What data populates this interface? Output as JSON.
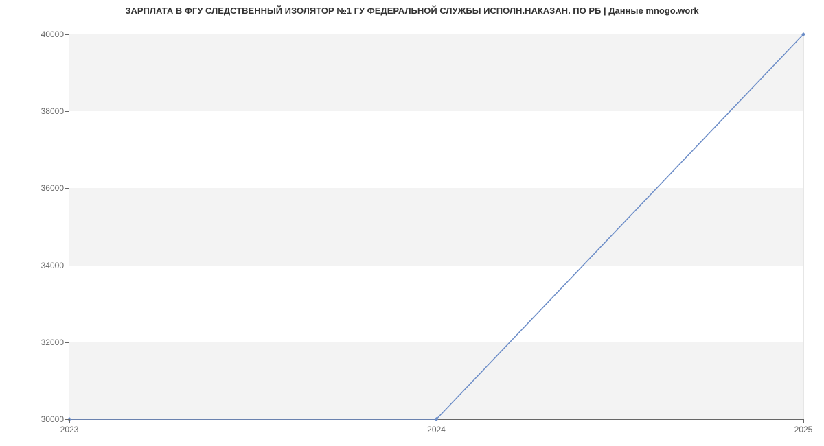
{
  "chart_data": {
    "type": "line",
    "title": "ЗАРПЛАТА В ФГУ СЛЕДСТВЕННЫЙ ИЗОЛЯТОР №1 ГУ ФЕДЕРАЛЬНОЙ СЛУЖБЫ ИСПОЛН.НАКАЗАН. ПО РБ | Данные mnogo.work",
    "xlabel": "",
    "ylabel": "",
    "x": [
      2023,
      2024,
      2025
    ],
    "y": [
      30000,
      30000,
      40000
    ],
    "xlim": [
      2023,
      2025
    ],
    "ylim": [
      30000,
      40000
    ],
    "y_ticks": [
      30000,
      32000,
      34000,
      36000,
      38000,
      40000
    ],
    "x_ticks": [
      2023,
      2024,
      2025
    ],
    "bands": [
      {
        "y0": 30000,
        "y1": 32000,
        "color": "#f3f3f3"
      },
      {
        "y0": 34000,
        "y1": 36000,
        "color": "#f3f3f3"
      },
      {
        "y0": 38000,
        "y1": 40000,
        "color": "#f3f3f3"
      }
    ],
    "line_color": "#6b8cc7",
    "marker": {
      "shape": "diamond",
      "size": 6,
      "fill": "#6b8cc7"
    }
  }
}
